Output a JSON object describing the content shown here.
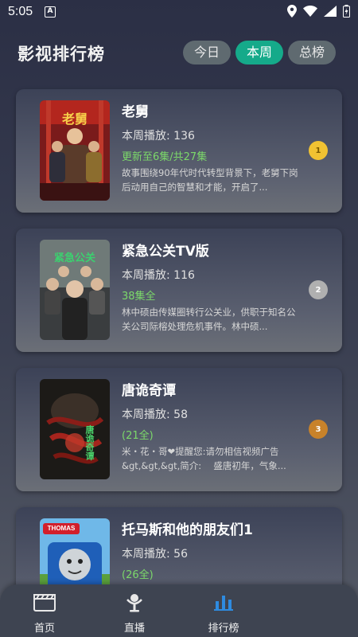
{
  "status_bar": {
    "time": "5:05",
    "notification_glyph": "A"
  },
  "header": {
    "title": "影视排行榜",
    "tabs": [
      {
        "label": "今日",
        "active": false
      },
      {
        "label": "本周",
        "active": true
      },
      {
        "label": "总榜",
        "active": false
      }
    ]
  },
  "colors": {
    "accent": "#15aa8a",
    "tab_inactive": "#5f6a70",
    "episode_text": "#7cd96a",
    "rank_gold": "#f1c232",
    "rank_silver": "#b0b0b0",
    "rank_bronze": "#c8822a"
  },
  "list": [
    {
      "title": "老舅",
      "plays": "本周播放: 136",
      "episode": "更新至6集/共27集",
      "desc": "故事围绕90年代时代转型背景下，老舅下岗后动用自己的智慧和才能，开启了...",
      "rank": "1",
      "rank_color": "#f1c232",
      "poster_text": "老舅"
    },
    {
      "title": "紧急公关TV版",
      "plays": "本周播放: 116",
      "episode": "38集全",
      "desc": "林中硕由传媒圈转行公关业，供职于知名公关公司际榕处理危机事件。林中硕...",
      "rank": "2",
      "rank_color": "#b0b0b0",
      "poster_text": "紧急公关"
    },
    {
      "title": "唐诡奇谭",
      "plays": "本周播放: 58",
      "episode": "(21全)",
      "desc": "米・花・哥❤提醒您:请勿相信视频广告&gt,&gt,&gt,简介:　 盛唐初年，气象...",
      "rank": "3",
      "rank_color": "#c8822a",
      "poster_text": "唐诡奇谭"
    },
    {
      "title": "托马斯和他的朋友们1",
      "plays": "本周播放: 56",
      "episode": "(26全)",
      "desc": "",
      "rank": "",
      "rank_color": "",
      "poster_text": "THOMAS"
    }
  ],
  "bottom_nav": [
    {
      "label": "首页",
      "icon": "clapperboard-icon",
      "active": false
    },
    {
      "label": "直播",
      "icon": "live-broadcast-icon",
      "active": false
    },
    {
      "label": "排行榜",
      "icon": "bar-chart-icon",
      "active": true
    }
  ]
}
